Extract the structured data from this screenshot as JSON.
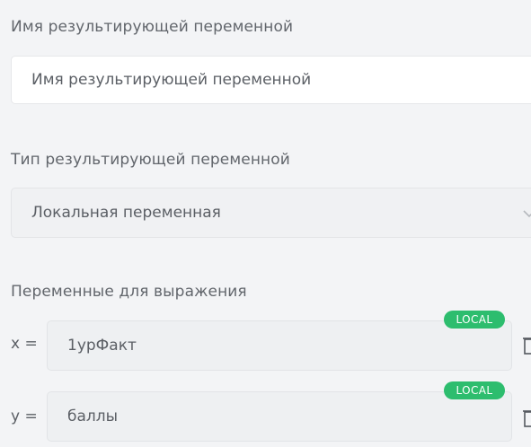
{
  "result_name": {
    "label": "Имя результирующей переменной",
    "placeholder": "Имя результирующей переменной"
  },
  "result_type": {
    "label": "Тип результирующей переменной",
    "selected": "Локальная переменная"
  },
  "expression_vars": {
    "label": "Переменные для выражения",
    "items": [
      {
        "name": "x =",
        "value": "1урФакт",
        "badge": "LOCAL"
      },
      {
        "name": "y =",
        "value": "баллы",
        "badge": "LOCAL"
      }
    ]
  },
  "colors": {
    "badge": "#2dbd6e",
    "background": "#f3f4f6"
  }
}
